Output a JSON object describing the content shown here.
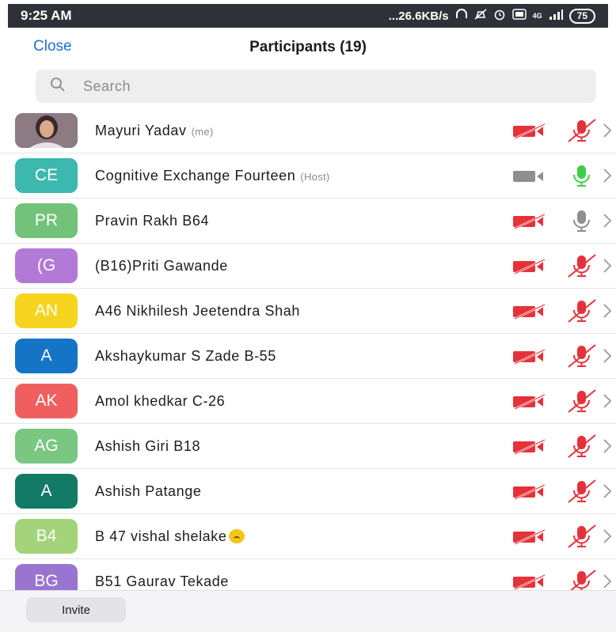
{
  "status_bar": {
    "time": "9:25 AM",
    "network_speed": "...26.6KB/s",
    "network_type": "4G",
    "battery": "75",
    "icons": [
      "headphones-icon",
      "mute-notifications-icon",
      "alarm-icon",
      "volte-icon",
      "signal-icon"
    ]
  },
  "header": {
    "close_label": "Close",
    "title": "Participants (19)"
  },
  "search": {
    "placeholder": "Search"
  },
  "participants": [
    {
      "initials": "",
      "name": "Mayuri Yadav",
      "tag": "(me)",
      "avatar_type": "photo",
      "avatar_color": "#6b5560",
      "video": "off",
      "audio": "muted"
    },
    {
      "initials": "CE",
      "name": "Cognitive Exchange Fourteen",
      "tag": "(Host)",
      "avatar_color": "#3db8ae",
      "video": "on",
      "audio": "active"
    },
    {
      "initials": "PR",
      "name": "Pravin Rakh B64",
      "tag": "",
      "avatar_color": "#72c27a",
      "video": "off",
      "audio": "on"
    },
    {
      "initials": "(G",
      "name": "(B16)Priti Gawande",
      "tag": "",
      "avatar_color": "#b27ad6",
      "video": "off",
      "audio": "muted"
    },
    {
      "initials": "AN",
      "name": "A46 Nikhilesh Jeetendra Shah",
      "tag": "",
      "avatar_color": "#f7d51e",
      "video": "off",
      "audio": "muted"
    },
    {
      "initials": "A",
      "name": "Akshaykumar S Zade B-55",
      "tag": "",
      "avatar_color": "#1674c7",
      "video": "off",
      "audio": "muted"
    },
    {
      "initials": "AK",
      "name": "Amol khedkar C-26",
      "tag": "",
      "avatar_color": "#f05f5f",
      "video": "off",
      "audio": "muted"
    },
    {
      "initials": "AG",
      "name": "Ashish Giri B18",
      "tag": "",
      "avatar_color": "#7ac781",
      "video": "off",
      "audio": "muted"
    },
    {
      "initials": "A",
      "name": "Ashish Patange",
      "tag": "",
      "avatar_color": "#127a66",
      "video": "off",
      "audio": "muted"
    },
    {
      "initials": "B4",
      "name": "B 47 vishal shelake",
      "tag": "",
      "avatar_color": "#a3d47a",
      "video": "off",
      "audio": "muted",
      "emoji": "upside-down-face-emoji"
    },
    {
      "initials": "BG",
      "name": "B51 Gaurav Tekade",
      "tag": "",
      "avatar_color": "#9a74d1",
      "video": "off",
      "audio": "muted"
    }
  ],
  "footer": {
    "invite_label": "Invite"
  },
  "colors": {
    "accent": "#1f6fd1",
    "muted_red": "#e5323a",
    "active_green": "#3ecf4a",
    "icon_gray": "#8e8e93"
  }
}
